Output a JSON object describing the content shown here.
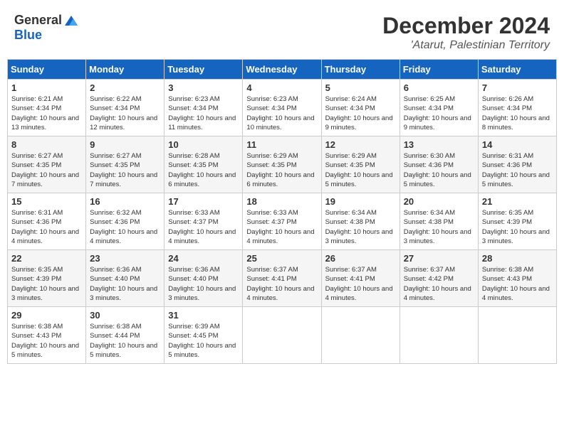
{
  "header": {
    "logo_general": "General",
    "logo_blue": "Blue",
    "month": "December 2024",
    "location": "'Atarut, Palestinian Territory"
  },
  "days_of_week": [
    "Sunday",
    "Monday",
    "Tuesday",
    "Wednesday",
    "Thursday",
    "Friday",
    "Saturday"
  ],
  "weeks": [
    [
      {
        "day": 1,
        "sunrise": "6:21 AM",
        "sunset": "4:34 PM",
        "daylight": "10 hours and 13 minutes."
      },
      {
        "day": 2,
        "sunrise": "6:22 AM",
        "sunset": "4:34 PM",
        "daylight": "10 hours and 12 minutes."
      },
      {
        "day": 3,
        "sunrise": "6:23 AM",
        "sunset": "4:34 PM",
        "daylight": "10 hours and 11 minutes."
      },
      {
        "day": 4,
        "sunrise": "6:23 AM",
        "sunset": "4:34 PM",
        "daylight": "10 hours and 10 minutes."
      },
      {
        "day": 5,
        "sunrise": "6:24 AM",
        "sunset": "4:34 PM",
        "daylight": "10 hours and 9 minutes."
      },
      {
        "day": 6,
        "sunrise": "6:25 AM",
        "sunset": "4:34 PM",
        "daylight": "10 hours and 9 minutes."
      },
      {
        "day": 7,
        "sunrise": "6:26 AM",
        "sunset": "4:34 PM",
        "daylight": "10 hours and 8 minutes."
      }
    ],
    [
      {
        "day": 8,
        "sunrise": "6:27 AM",
        "sunset": "4:35 PM",
        "daylight": "10 hours and 7 minutes."
      },
      {
        "day": 9,
        "sunrise": "6:27 AM",
        "sunset": "4:35 PM",
        "daylight": "10 hours and 7 minutes."
      },
      {
        "day": 10,
        "sunrise": "6:28 AM",
        "sunset": "4:35 PM",
        "daylight": "10 hours and 6 minutes."
      },
      {
        "day": 11,
        "sunrise": "6:29 AM",
        "sunset": "4:35 PM",
        "daylight": "10 hours and 6 minutes."
      },
      {
        "day": 12,
        "sunrise": "6:29 AM",
        "sunset": "4:35 PM",
        "daylight": "10 hours and 5 minutes."
      },
      {
        "day": 13,
        "sunrise": "6:30 AM",
        "sunset": "4:36 PM",
        "daylight": "10 hours and 5 minutes."
      },
      {
        "day": 14,
        "sunrise": "6:31 AM",
        "sunset": "4:36 PM",
        "daylight": "10 hours and 5 minutes."
      }
    ],
    [
      {
        "day": 15,
        "sunrise": "6:31 AM",
        "sunset": "4:36 PM",
        "daylight": "10 hours and 4 minutes."
      },
      {
        "day": 16,
        "sunrise": "6:32 AM",
        "sunset": "4:36 PM",
        "daylight": "10 hours and 4 minutes."
      },
      {
        "day": 17,
        "sunrise": "6:33 AM",
        "sunset": "4:37 PM",
        "daylight": "10 hours and 4 minutes."
      },
      {
        "day": 18,
        "sunrise": "6:33 AM",
        "sunset": "4:37 PM",
        "daylight": "10 hours and 4 minutes."
      },
      {
        "day": 19,
        "sunrise": "6:34 AM",
        "sunset": "4:38 PM",
        "daylight": "10 hours and 3 minutes."
      },
      {
        "day": 20,
        "sunrise": "6:34 AM",
        "sunset": "4:38 PM",
        "daylight": "10 hours and 3 minutes."
      },
      {
        "day": 21,
        "sunrise": "6:35 AM",
        "sunset": "4:39 PM",
        "daylight": "10 hours and 3 minutes."
      }
    ],
    [
      {
        "day": 22,
        "sunrise": "6:35 AM",
        "sunset": "4:39 PM",
        "daylight": "10 hours and 3 minutes."
      },
      {
        "day": 23,
        "sunrise": "6:36 AM",
        "sunset": "4:40 PM",
        "daylight": "10 hours and 3 minutes."
      },
      {
        "day": 24,
        "sunrise": "6:36 AM",
        "sunset": "4:40 PM",
        "daylight": "10 hours and 3 minutes."
      },
      {
        "day": 25,
        "sunrise": "6:37 AM",
        "sunset": "4:41 PM",
        "daylight": "10 hours and 4 minutes."
      },
      {
        "day": 26,
        "sunrise": "6:37 AM",
        "sunset": "4:41 PM",
        "daylight": "10 hours and 4 minutes."
      },
      {
        "day": 27,
        "sunrise": "6:37 AM",
        "sunset": "4:42 PM",
        "daylight": "10 hours and 4 minutes."
      },
      {
        "day": 28,
        "sunrise": "6:38 AM",
        "sunset": "4:43 PM",
        "daylight": "10 hours and 4 minutes."
      }
    ],
    [
      {
        "day": 29,
        "sunrise": "6:38 AM",
        "sunset": "4:43 PM",
        "daylight": "10 hours and 5 minutes."
      },
      {
        "day": 30,
        "sunrise": "6:38 AM",
        "sunset": "4:44 PM",
        "daylight": "10 hours and 5 minutes."
      },
      {
        "day": 31,
        "sunrise": "6:39 AM",
        "sunset": "4:45 PM",
        "daylight": "10 hours and 5 minutes."
      },
      null,
      null,
      null,
      null
    ]
  ]
}
